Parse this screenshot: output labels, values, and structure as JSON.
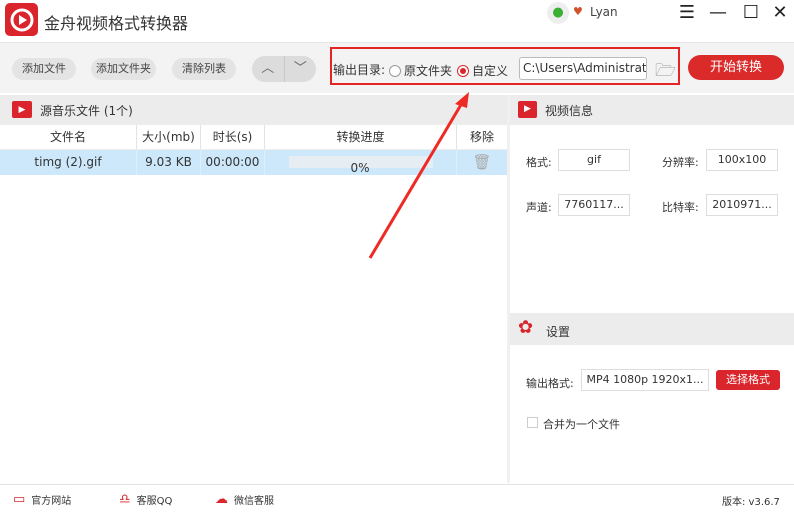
{
  "app": {
    "title": "金舟视频格式转换器",
    "user": "Lyan"
  },
  "toolbar": {
    "add_file": "添加文件",
    "add_folder": "添加文件夹",
    "clear_list": "清除列表",
    "output_dir_label": "输出目录:",
    "radio_source": "原文件夹",
    "radio_custom": "自定义",
    "path": "C:\\Users\\Administrator\\",
    "start": "开始转换"
  },
  "files": {
    "header": "源音乐文件 (1个)",
    "columns": [
      "文件名",
      "大小(mb)",
      "时长(s)",
      "转换进度",
      "移除"
    ],
    "rows": [
      {
        "name": "timg (2).gif",
        "size": "9.03 KB",
        "duration": "00:00:00",
        "progress": "0%"
      }
    ]
  },
  "video_info": {
    "title": "视频信息",
    "format_label": "格式:",
    "format": "gif",
    "resolution_label": "分辨率:",
    "resolution": "100x100",
    "channel_label": "声道:",
    "channel": "7760117...",
    "bitrate_label": "比特率:",
    "bitrate": "2010971..."
  },
  "settings": {
    "title": "设置",
    "output_format_label": "输出格式:",
    "output_format": "MP4 1080p 1920x1...",
    "select_format": "选择格式",
    "merge_label": "合并为一个文件"
  },
  "footer": {
    "website": "官方网站",
    "qq": "客服QQ",
    "wechat": "微信客服",
    "version": "版本: v3.6.7"
  },
  "colors": {
    "accent": "#d9252b",
    "selected_row": "#cde8fb"
  }
}
